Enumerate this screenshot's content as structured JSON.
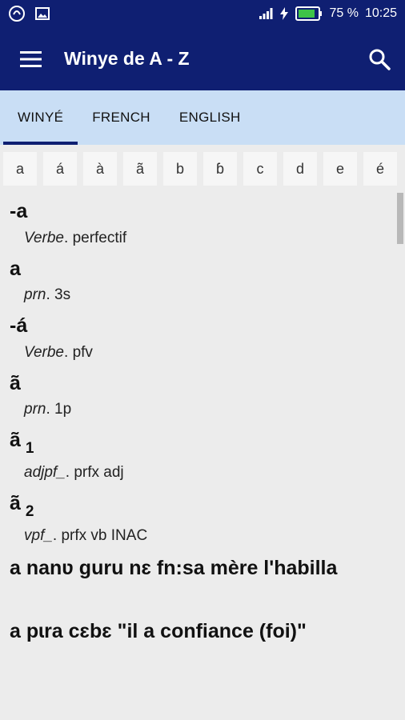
{
  "status": {
    "battery": "75 %",
    "time": "10:25"
  },
  "appbar": {
    "title": "Winye de A - Z"
  },
  "tabs": [
    "WINYÉ",
    "FRENCH",
    "ENGLISH"
  ],
  "letters": [
    "a",
    "á",
    "à",
    "ã",
    "b",
    "ɓ",
    "c",
    "d",
    "e",
    "é"
  ],
  "entries": [
    {
      "head": "-a",
      "pos": "Verbe",
      "gloss": "perfectif"
    },
    {
      "head": "a",
      "pos": "prn",
      "gloss": "3s"
    },
    {
      "head": "-á",
      "pos": "Verbe",
      "gloss": "pfv"
    },
    {
      "head": "ã",
      "pos": "prn",
      "gloss": "1p"
    },
    {
      "head": "ã",
      "num": "1",
      "pos": "adjpf_",
      "gloss": "prfx adj"
    },
    {
      "head": "ã",
      "num": "2",
      "pos": "vpf_",
      "gloss": "prfx vb INAC"
    },
    {
      "head": "a nanʋ guru nɛ fn:sa mère l'habilla"
    },
    {
      "head": "a pɩra cɛbɛ \"il a confiance (foi)\""
    }
  ]
}
